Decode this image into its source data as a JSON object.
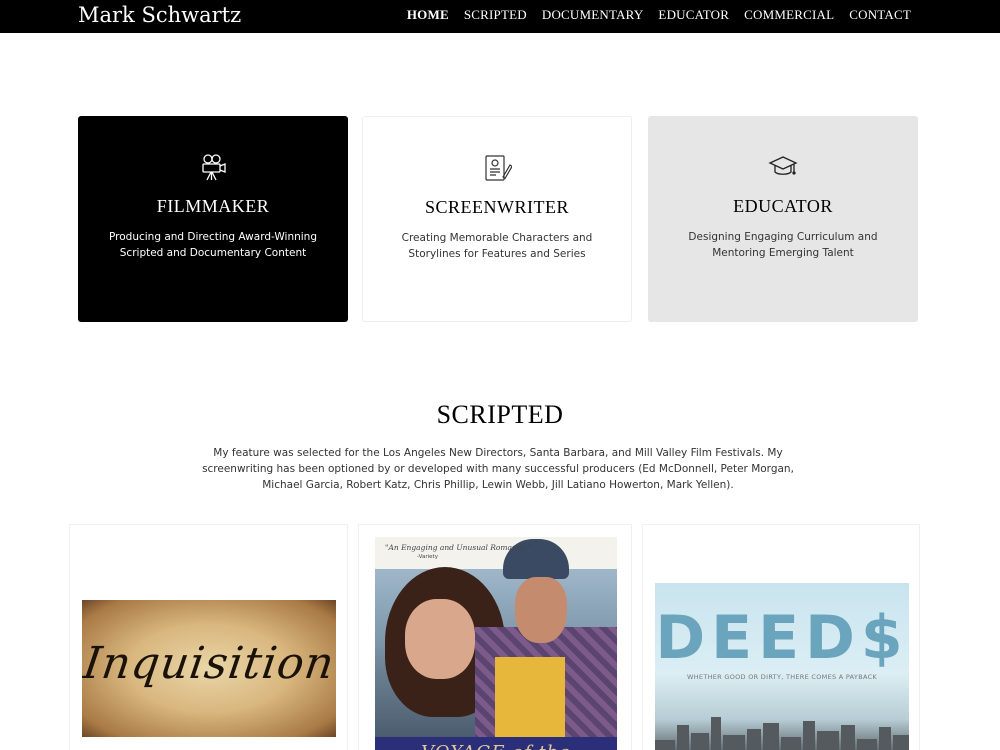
{
  "header": {
    "brand": "Mark Schwartz",
    "nav": [
      "HOME",
      "SCRIPTED",
      "DOCUMENTARY",
      "EDUCATOR",
      "COMMERCIAL",
      "CONTACT"
    ]
  },
  "cards": [
    {
      "title": "FILMMAKER",
      "description": "Producing and Directing Award-Winning Scripted and Documentary Content",
      "icon": "film-camera-icon"
    },
    {
      "title": "SCREENWRITER",
      "description": "Creating Memorable Characters and Storylines for Features and Series",
      "icon": "script-pen-icon"
    },
    {
      "title": "EDUCATOR",
      "description": "Designing Engaging Curriculum and Mentoring Emerging Talent",
      "icon": "graduation-cap-icon"
    }
  ],
  "section": {
    "title": "SCRIPTED",
    "body": "My feature was selected for the Los Angeles New Directors, Santa Barbara, and Mill Valley Film Festivals. My screenwriting has been optioned by or developed with many successful producers (Ed McDonnell, Peter Morgan, Michael Garcia, Robert Katz, Chris Phillip, Lewin Webb, Jill Latiano Howerton, Mark Yellen)."
  },
  "posters": {
    "inquisition": {
      "title": "Inquisition"
    },
    "voyage": {
      "quote": "\"An Engaging and Unusual Romance.\"",
      "source": "-Variety",
      "title": "VOYAGE of the"
    },
    "deeds": {
      "title": "DEED$",
      "tagline": "WHETHER GOOD OR DIRTY, THERE COMES A PAYBACK"
    }
  },
  "colors": {
    "topbar": "#000000",
    "dark_card": "#000000",
    "grey_card": "#e6e6e6",
    "deeds_title": "#6aa4bd"
  }
}
